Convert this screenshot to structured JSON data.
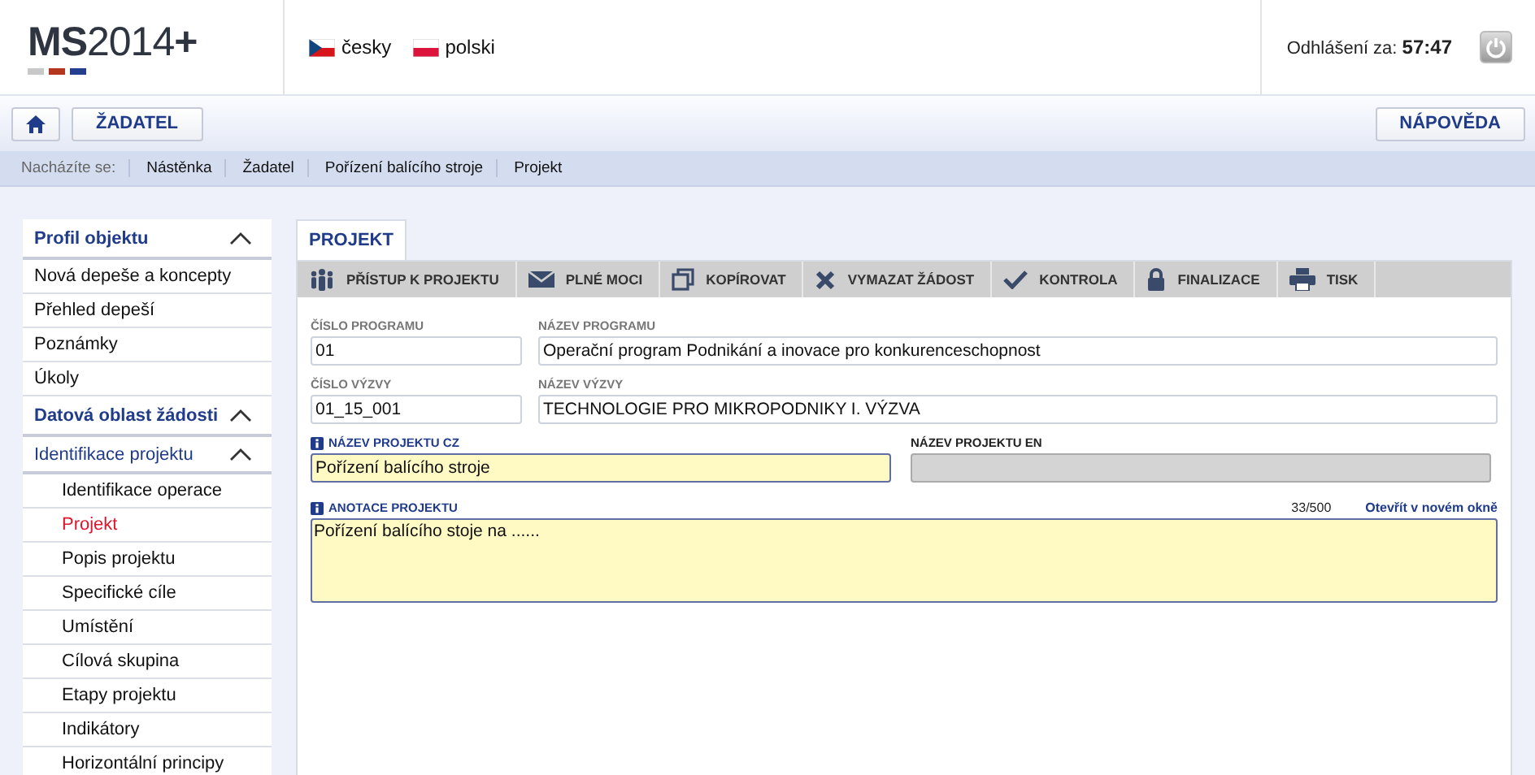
{
  "logo": {
    "text": "**MS**2014**+**"
  },
  "languages": [
    {
      "label": "česky",
      "kind": "cz"
    },
    {
      "label": "polski",
      "kind": "pl"
    }
  ],
  "session": {
    "label": "Odhlášení za:",
    "time": "57:47"
  },
  "toolbar": {
    "buttons": [
      "ŽADATEL"
    ],
    "help": "NÁPOVĚDA"
  },
  "breadcrumb": {
    "label": "Nacházíte se:",
    "items": [
      "Nástěnka",
      "Žadatel",
      "Pořízení balícího stroje",
      "Projekt"
    ]
  },
  "sidebar": {
    "items": [
      {
        "label": "Profil objektu",
        "expanded": true,
        "selected": false,
        "children": [
          {
            "label": "Nová depeše a koncepty",
            "selected": false
          },
          {
            "label": "Přehled depeší",
            "selected": false
          },
          {
            "label": "Poznámky",
            "selected": false
          },
          {
            "label": "Úkoly",
            "selected": false
          }
        ]
      },
      {
        "label": "Datová oblast žádosti",
        "expanded": true,
        "selected": false,
        "children": [
          {
            "label": "Identifikace projektu",
            "expanded": true,
            "selected": false,
            "children": [
              {
                "label": "Identifikace operace",
                "selected": false
              },
              {
                "label": "Projekt",
                "selected": true
              },
              {
                "label": "Popis projektu",
                "selected": false
              },
              {
                "label": "Specifické cíle",
                "selected": false
              },
              {
                "label": "Umístění",
                "selected": false
              },
              {
                "label": "Cílová skupina",
                "selected": false
              },
              {
                "label": "Etapy projektu",
                "selected": false
              },
              {
                "label": "Indikátory",
                "selected": false
              },
              {
                "label": "Horizontální principy",
                "selected": false
              }
            ]
          }
        ]
      }
    ]
  },
  "tab": {
    "label": "PROJEKT",
    "selected": true
  },
  "actions": [
    {
      "label": "PŘÍSTUP K PROJEKTU",
      "kind": "people"
    },
    {
      "label": "PLNÉ MOCI",
      "kind": "mail"
    },
    {
      "label": "KOPÍROVAT",
      "kind": "copy"
    },
    {
      "label": "VYMAZAT ŽÁDOST",
      "kind": "cross"
    },
    {
      "label": "KONTROLA",
      "kind": "check"
    },
    {
      "label": "FINALIZACE",
      "kind": "lock"
    },
    {
      "label": "TISK",
      "kind": "print"
    }
  ],
  "form": {
    "rows": [
      [
        {
          "label": "ČÍSLO PROGRAMU",
          "value": "01",
          "required": false,
          "disabled": false
        },
        {
          "label": "NÁZEV PROGRAMU",
          "value": "Operační program Podnikání a inovace pro konkurenceschopnost",
          "required": false,
          "disabled": false
        }
      ],
      [
        {
          "label": "ČÍSLO VÝZVY",
          "value": "01_15_001",
          "required": false,
          "disabled": false
        },
        {
          "label": "NÁZEV VÝZVY",
          "value": "TECHNOLOGIE PRO MIKROPODNIKY I. VÝZVA",
          "required": false,
          "disabled": false
        }
      ],
      [
        {
          "label": "NÁZEV PROJEKTU CZ",
          "value": "Pořízení balícího stroje",
          "required": true,
          "disabled": false
        },
        {
          "label": "NÁZEV PROJEKTU EN",
          "required": false,
          "disabled": true
        }
      ]
    ],
    "annotation": {
      "label": "ANOTACE PROJEKTU",
      "required": true,
      "counter": "33/500",
      "link": "Otevřít v novém okně",
      "value": "Pořízení balícího stoje na ......"
    }
  }
}
